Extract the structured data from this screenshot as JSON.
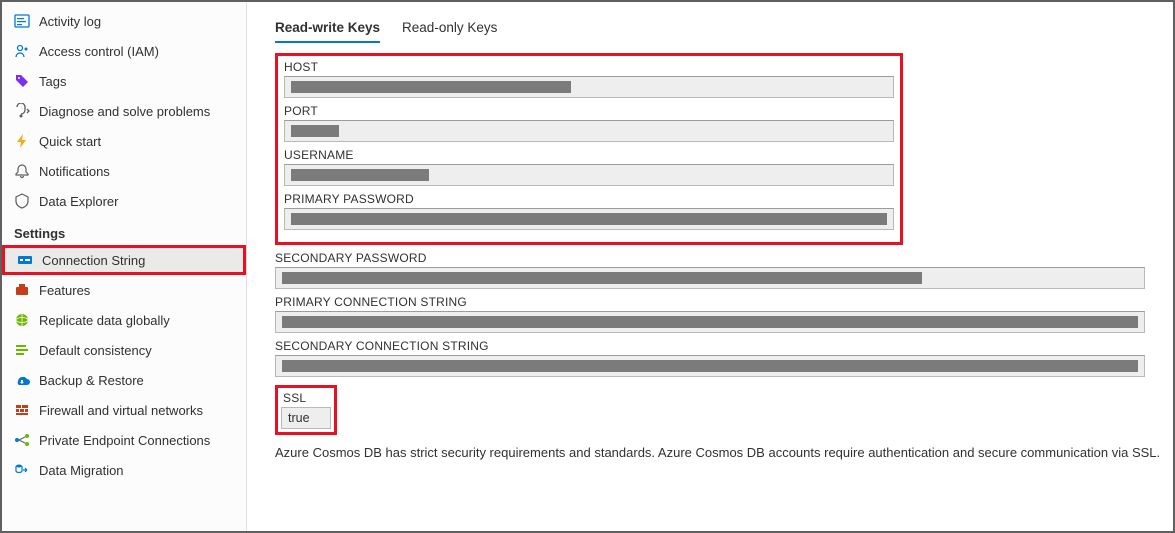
{
  "sidebar": {
    "items_top": [
      {
        "label": "Activity log",
        "icon": "activity-log-icon"
      },
      {
        "label": "Access control (IAM)",
        "icon": "access-control-icon"
      },
      {
        "label": "Tags",
        "icon": "tags-icon"
      },
      {
        "label": "Diagnose and solve problems",
        "icon": "diagnose-icon"
      },
      {
        "label": "Quick start",
        "icon": "quick-start-icon"
      },
      {
        "label": "Notifications",
        "icon": "notifications-icon"
      },
      {
        "label": "Data Explorer",
        "icon": "data-explorer-icon"
      }
    ],
    "section_label": "Settings",
    "items_settings": [
      {
        "label": "Connection String",
        "icon": "connection-string-icon",
        "selected": true
      },
      {
        "label": "Features",
        "icon": "features-icon"
      },
      {
        "label": "Replicate data globally",
        "icon": "replicate-icon"
      },
      {
        "label": "Default consistency",
        "icon": "consistency-icon"
      },
      {
        "label": "Backup & Restore",
        "icon": "backup-icon"
      },
      {
        "label": "Firewall and virtual networks",
        "icon": "firewall-icon"
      },
      {
        "label": "Private Endpoint Connections",
        "icon": "private-endpoint-icon"
      },
      {
        "label": "Data Migration",
        "icon": "data-migration-icon"
      }
    ]
  },
  "main": {
    "tabs": [
      {
        "label": "Read-write Keys",
        "active": true
      },
      {
        "label": "Read-only Keys",
        "active": false
      }
    ],
    "fields_highlighted": [
      {
        "label": "HOST",
        "redact_width": 280
      },
      {
        "label": "PORT",
        "redact_width": 48
      },
      {
        "label": "USERNAME",
        "redact_width": 138
      },
      {
        "label": "PRIMARY PASSWORD",
        "redact_width": 601
      }
    ],
    "fields_rest": [
      {
        "label": "SECONDARY PASSWORD",
        "redact_width": 640
      },
      {
        "label": "PRIMARY CONNECTION STRING",
        "redact_width": 862
      },
      {
        "label": "SECONDARY CONNECTION STRING",
        "redact_width": 862
      }
    ],
    "ssl": {
      "label": "SSL",
      "value": "true"
    },
    "footer": "Azure Cosmos DB has strict security requirements and standards. Azure Cosmos DB accounts require authentication and secure communication via SSL."
  }
}
